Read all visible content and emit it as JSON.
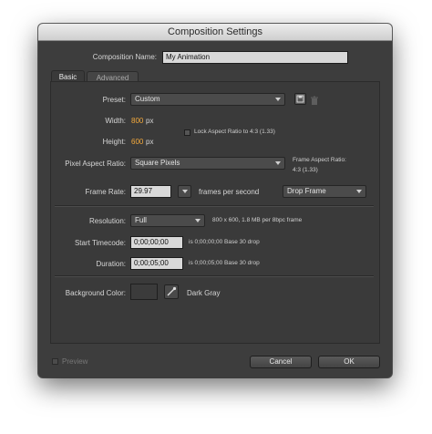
{
  "window": {
    "title": "Composition Settings"
  },
  "composition_name": {
    "label": "Composition Name:",
    "value": "My Animation"
  },
  "tabs": [
    {
      "label": "Basic",
      "active": true
    },
    {
      "label": "Advanced",
      "active": false
    }
  ],
  "preset": {
    "label": "Preset:",
    "value": "Custom"
  },
  "width": {
    "label": "Width:",
    "value": "800",
    "unit": "px"
  },
  "height": {
    "label": "Height:",
    "value": "600",
    "unit": "px"
  },
  "lock_aspect": {
    "label": "Lock Aspect Ratio to 4:3 (1.33)",
    "checked": false
  },
  "pixel_aspect": {
    "label": "Pixel Aspect Ratio:",
    "value": "Square Pixels"
  },
  "frame_aspect": {
    "line1": "Frame Aspect Ratio:",
    "line2": "4:3 (1.33)"
  },
  "frame_rate": {
    "label": "Frame Rate:",
    "value": "29.97",
    "unit": "frames per second",
    "mode": "Drop Frame"
  },
  "resolution": {
    "label": "Resolution:",
    "value": "Full",
    "info": "800 x 600, 1.8 MB per 8bpc frame"
  },
  "start_timecode": {
    "label": "Start Timecode:",
    "value": "0;00;00;00",
    "info": "is 0;00;00;00  Base 30  drop"
  },
  "duration": {
    "label": "Duration:",
    "value": "0;00;05;00",
    "info": "is 0;00;05;00  Base 30  drop"
  },
  "background": {
    "label": "Background Color:",
    "color_name": "Dark Gray",
    "color": "#3b3b3b"
  },
  "footer": {
    "preview_label": "Preview",
    "cancel_label": "Cancel",
    "ok_label": "OK"
  },
  "colors": {
    "accent_value": "#f3a93c",
    "dialog_bg": "#3d3d3d"
  },
  "icons": [
    "save-preset-icon",
    "delete-preset-icon",
    "eyedropper-icon"
  ]
}
